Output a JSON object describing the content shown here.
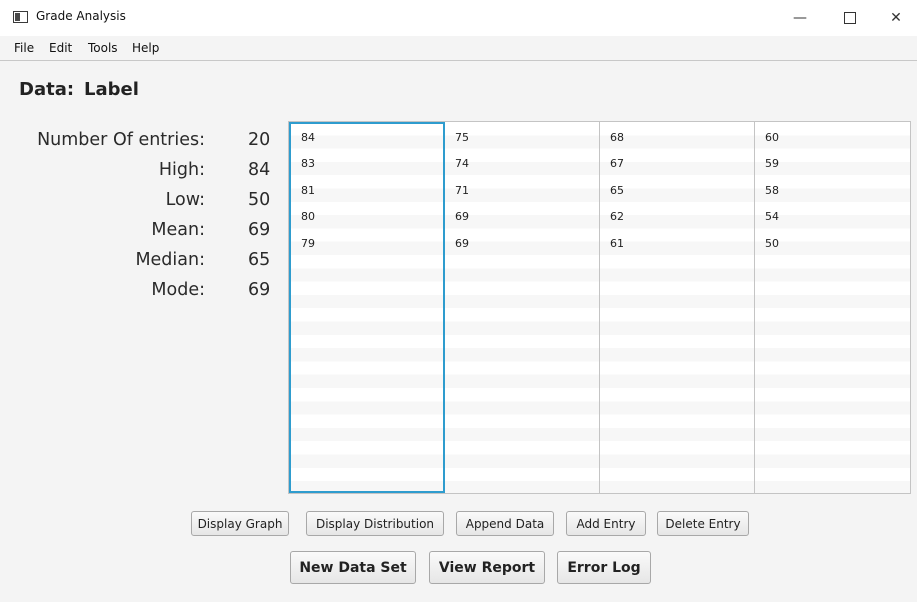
{
  "window": {
    "title": "Grade Analysis",
    "controls": {
      "minimize": "—",
      "close": "✕"
    }
  },
  "menu": [
    "File",
    "Edit",
    "Tools",
    "Help"
  ],
  "heading": {
    "prefix": "Data:",
    "label": "Label"
  },
  "stats": [
    {
      "label": "Number Of entries:",
      "value": "20"
    },
    {
      "label": "High:",
      "value": "84"
    },
    {
      "label": "Low:",
      "value": "50"
    },
    {
      "label": "Mean:",
      "value": "69"
    },
    {
      "label": "Median:",
      "value": "65"
    },
    {
      "label": "Mode:",
      "value": "69"
    }
  ],
  "grid": {
    "columns": [
      [
        "84",
        "83",
        "81",
        "80",
        "79"
      ],
      [
        "75",
        "74",
        "71",
        "69",
        "69"
      ],
      [
        "68",
        "67",
        "65",
        "62",
        "61"
      ],
      [
        "60",
        "59",
        "58",
        "54",
        "50"
      ]
    ],
    "selected_column": 0,
    "accent_color": "#2e9cce"
  },
  "buttons": {
    "display_graph": "Display Graph",
    "display_distribution": "Display Distribution",
    "append_data": "Append Data",
    "add_entry": "Add Entry",
    "delete_entry": "Delete Entry",
    "new_data_set": "New Data Set",
    "view_report": "View Report",
    "error_log": "Error Log"
  }
}
